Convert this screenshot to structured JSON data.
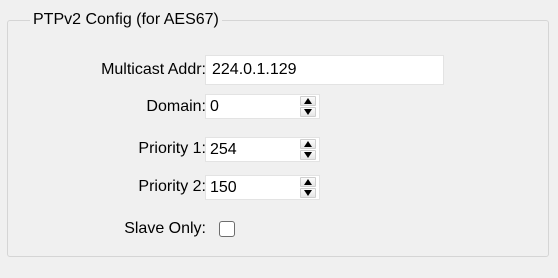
{
  "group": {
    "title": "PTPv2 Config (for AES67)"
  },
  "fields": {
    "multicast_label": "Multicast Addr:",
    "multicast_value": "224.0.1.129",
    "domain_label": "Domain:",
    "domain_value": "0",
    "priority1_label": "Priority 1:",
    "priority1_value": "254",
    "priority2_label": "Priority 2:",
    "priority2_value": "150",
    "slave_only_label": "Slave Only:",
    "slave_only_checked": false
  },
  "icons": {
    "spin_up": "up-arrow-icon",
    "spin_down": "down-arrow-icon"
  }
}
